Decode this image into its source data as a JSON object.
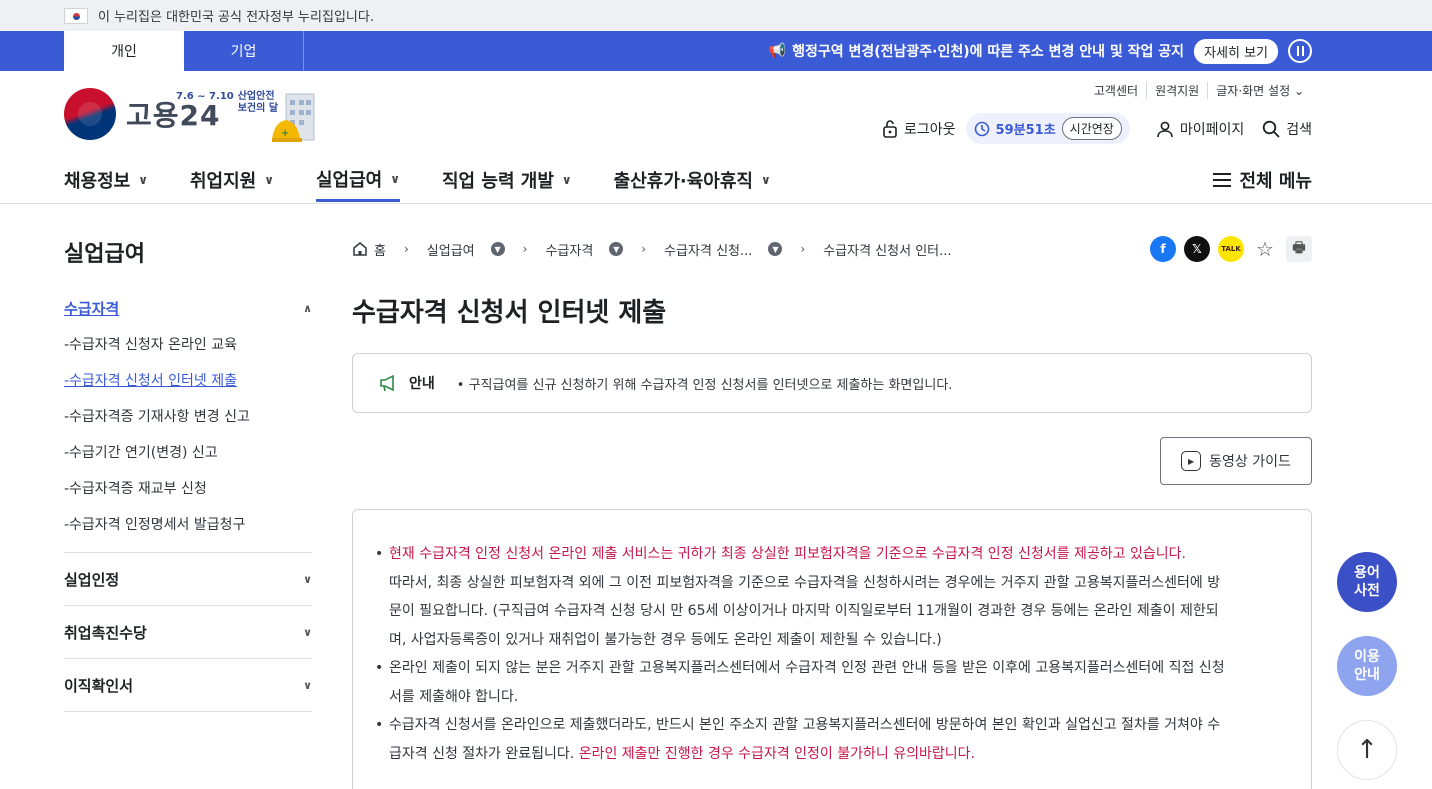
{
  "gov_banner": {
    "text": "이 누리집은 대한민국 공식 전자정부 누리집입니다."
  },
  "top_tabs": [
    "개인",
    "기업"
  ],
  "notice": {
    "text": "행정구역 변경(전남광주·인천)에 따른 주소 변경 안내 및 작업 공지",
    "detail_label": "자세히 보기"
  },
  "logo": {
    "text": "고용24",
    "event_dates": "7.6 ~ 7.10",
    "event_line1": "산업안전",
    "event_line2": "보건의 달"
  },
  "utility": [
    "고객센터",
    "원격지원",
    "글자·화면 설정"
  ],
  "user": {
    "logout": "로그아웃",
    "timer": "59분51초",
    "extend": "시간연장",
    "mypage": "마이페이지",
    "search": "검색"
  },
  "gnb": {
    "items": [
      "채용정보",
      "취업지원",
      "실업급여",
      "직업 능력 개발",
      "출산휴가·육아휴직"
    ],
    "all_menu": "전체 메뉴"
  },
  "lnb": {
    "title": "실업급여",
    "main": "수급자격",
    "subs": [
      "-수급자격 신청자 온라인 교육",
      "-수급자격 신청서 인터넷 제출",
      "-수급자격증 기재사항 변경 신고",
      "-수급기간 연기(변경) 신고",
      "-수급자격증 재교부 신청",
      "-수급자격 인정명세서 발급청구"
    ],
    "groups": [
      "실업인정",
      "취업촉진수당",
      "이직확인서"
    ]
  },
  "breadcrumb": [
    "홈",
    "실업급여",
    "수급자격",
    "수급자격 신청...",
    "수급자격 신청서 인터..."
  ],
  "page_title": "수급자격 신청서 인터넷 제출",
  "info": {
    "label": "안내",
    "text": "• 구직급여를 신규 신청하기 위해 수급자격 인정 신청서를 인터넷으로 제출하는 화면입니다."
  },
  "video_guide": "동영상 가이드",
  "content": {
    "p1_red": "현재 수급자격 인정 신청서 온라인 제출 서비스는 귀하가 최종 상실한 피보험자격을 기준으로 수급자격 인정 신청서를 제공하고 있습니다.",
    "p1_l2": "따라서, 최종 상실한 피보험자격 외에 그 이전 피보험자격을 기준으로 수급자격을 신청하시려는 경우에는 거주지 관할 고용복지플러스센터에 방",
    "p1_l3": "문이 필요합니다. (구직급여 수급자격 신청 당시 만 65세 이상이거나 마지막 이직일로부터 11개월이 경과한 경우 등에는 온라인 제출이 제한되",
    "p1_l4": "며, 사업자등록증이 있거나 재취업이 불가능한 경우 등에도 온라인 제출이 제한될 수 있습니다.)",
    "p2_l1": "온라인 제출이 되지 않는 분은 거주지 관할 고용복지플러스센터에서 수급자격 인정 관련 안내 등을 받은 이후에 고용복지플러스센터에 직접 신청",
    "p2_l2": "서를 제출해야 합니다.",
    "p3_l1": "수급자격 신청서를 온라인으로 제출했더라도, 반드시 본인 주소지 관할 고용복지플러스센터에 방문하여 본인 확인과 실업신고 절차를 거쳐야 수",
    "p3_l2": "급자격 신청 절차가 완료됩니다.",
    "p3_red": "온라인 제출만 진행한 경우 수급자격 인정이 불가하니 유의바랍니다."
  },
  "floating": {
    "term_l1": "용어",
    "term_l2": "사전",
    "guide_l1": "이용",
    "guide_l2": "안내",
    "top": "↑"
  }
}
